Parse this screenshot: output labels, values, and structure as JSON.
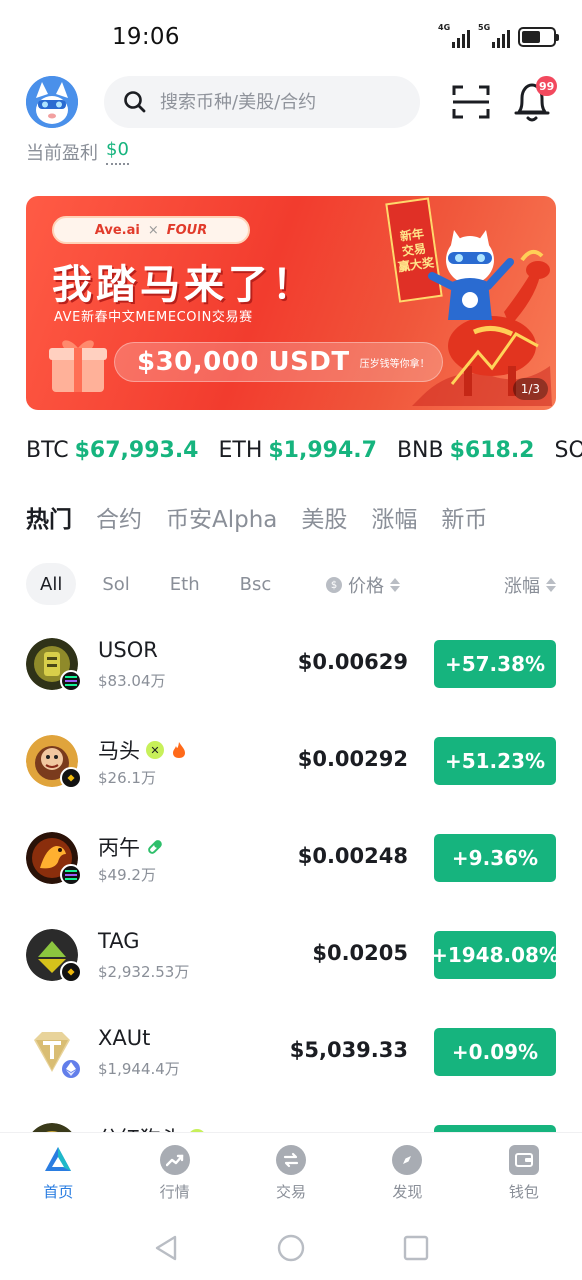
{
  "status_bar": {
    "time": "19:06",
    "signal_1": "4G",
    "signal_2": "5G"
  },
  "header": {
    "search_placeholder": "搜索币种/美股/合约",
    "notification_count": "99",
    "profit_label": "当前盈利",
    "profit_value": "$0"
  },
  "banner": {
    "partner_a": "Ave.ai",
    "separator": "×",
    "partner_b": "FOUR",
    "headline": "我踏马来了！",
    "subtitle": "AVE新春中文MEMECOIN交易赛",
    "prize": "$30,000 USDT",
    "prize_note": "压岁钱等你拿！",
    "ribbon_lines": [
      "新年",
      "交易",
      "赢大奖"
    ],
    "pager": "1/3"
  },
  "ticker": [
    {
      "symbol": "BTC",
      "price": "$67,993.4"
    },
    {
      "symbol": "ETH",
      "price": "$1,994.7"
    },
    {
      "symbol": "BNB",
      "price": "$618.2"
    },
    {
      "symbol": "SOL",
      "price": ""
    }
  ],
  "category_tabs": [
    "热门",
    "合约",
    "币安Alpha",
    "美股",
    "涨幅",
    "新币"
  ],
  "chain_filters": [
    "All",
    "Sol",
    "Eth",
    "Bsc"
  ],
  "columns": {
    "price": "价格",
    "change": "涨幅"
  },
  "tokens": [
    {
      "name": "USOR",
      "cap": "$83.04万",
      "price": "$0.00629",
      "change": "+57.38%",
      "chain": "sol"
    },
    {
      "name": "马头",
      "cap": "$26.1万",
      "price": "$0.00292",
      "change": "+51.23%",
      "chain": "bsc"
    },
    {
      "name": "丙午",
      "cap": "$49.2万",
      "price": "$0.00248",
      "change": "+9.36%",
      "chain": "sol"
    },
    {
      "name": "TAG",
      "cap": "$2,932.53万",
      "price": "$0.0205",
      "change": "+1948.08%",
      "chain": "bsc"
    },
    {
      "name": "XAUt",
      "cap": "$1,944.4万",
      "price": "$5,039.33",
      "change": "+0.09%",
      "chain": "eth"
    },
    {
      "name": "分红狗头",
      "cap": "",
      "price": "",
      "change": "",
      "chain": "bsc"
    }
  ],
  "bottom_nav": [
    "首页",
    "行情",
    "交易",
    "发现",
    "钱包"
  ],
  "colors": {
    "up_green": "#16b47e",
    "accent_blue": "#2a7de1",
    "badge_red": "#f2495e"
  }
}
